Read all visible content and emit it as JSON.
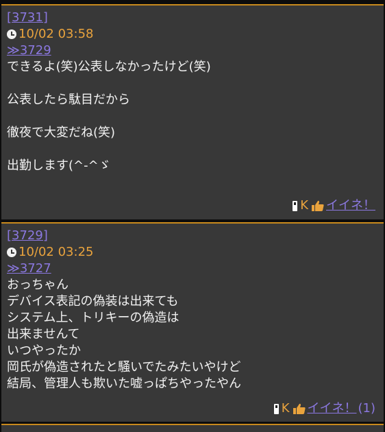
{
  "posts": [
    {
      "id": "[3731]",
      "time": "10/02 03:58",
      "reply": "≫3729",
      "lines": [
        "できるよ(笑)公表しなかったけど(笑)",
        "",
        "公表したら駄目だから",
        "",
        "徹夜で大変だね(笑)",
        "",
        "出勤します(^-^ゞ"
      ],
      "footer": {
        "k_label": "K",
        "like_label": "イイネ！",
        "like_count": ""
      }
    },
    {
      "id": "[3729]",
      "time": "10/02 03:25",
      "reply": "≫3727",
      "lines": [
        "おっちゃん",
        "デバイス表記の偽装は出来ても",
        "システム上、トリキーの偽造は",
        "出来ませんて",
        "いつやったか",
        "岡氏が偽造されたと騒いでたみたいやけど",
        "結局、管理人も欺いた嘘っぱちやったやん"
      ],
      "footer": {
        "k_label": "K",
        "like_label": "イイネ！",
        "like_count": "(1)"
      }
    }
  ],
  "colors": {
    "background": "#0c0c0c",
    "post_bg": "#383838",
    "accent_border": "#c98a1c",
    "link": "#8b78e0",
    "time": "#e9a33d",
    "text": "#f2f2f2"
  }
}
